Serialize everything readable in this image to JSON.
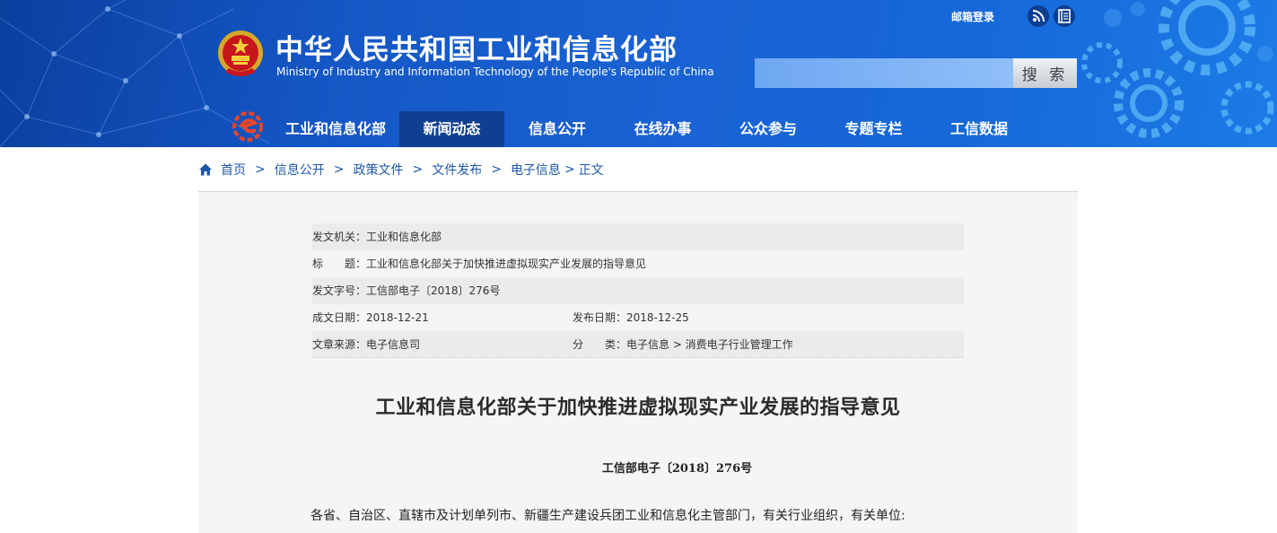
{
  "header": {
    "title": "中华人民共和国工业和信息化部",
    "subtitle": "Ministry of Industry and Information Technology of the People's Republic of China",
    "mail_login": "邮箱登录",
    "search_placeholder": "",
    "search_button": "搜 索"
  },
  "nav": {
    "items": [
      {
        "label": "工业和信息化部",
        "active": false
      },
      {
        "label": "新闻动态",
        "active": true
      },
      {
        "label": "信息公开",
        "active": false
      },
      {
        "label": "在线办事",
        "active": false
      },
      {
        "label": "公众参与",
        "active": false
      },
      {
        "label": "专题专栏",
        "active": false
      },
      {
        "label": "工信数据",
        "active": false
      }
    ]
  },
  "breadcrumb": {
    "items": [
      "首页",
      "信息公开",
      "政策文件",
      "文件发布",
      "电子信息",
      "正文"
    ],
    "separator": ">"
  },
  "meta": {
    "issuer_label": "发文机关：",
    "issuer": "工业和信息化部",
    "title_label": "标　　题：",
    "title": "工业和信息化部关于加快推进虚拟现实产业发展的指导意见",
    "doc_no_label": "发文字号：",
    "doc_no": "工信部电子〔2018〕276号",
    "created_label": "成文日期：",
    "created": "2018-12-21",
    "published_label": "发布日期：",
    "published": "2018-12-25",
    "source_label": "文章来源：",
    "source": "电子信息司",
    "category_label": "分　　类：",
    "category": "电子信息 > 消费电子行业管理工作"
  },
  "document": {
    "title": "工业和信息化部关于加快推进虚拟现实产业发展的指导意见",
    "number": "工信部电子〔2018〕276号",
    "salutation": "各省、自治区、直辖市及计划单列市、新疆生产建设兵团工业和信息化主管部门，有关行业组织，有关单位:"
  },
  "colors": {
    "header_blue": "#1456c4",
    "nav_active": "#0f3f90",
    "link_blue": "#1f57a8",
    "content_bg": "#f5f5f5"
  },
  "icons": [
    "national-emblem-icon",
    "rss-icon",
    "list-icon",
    "miit-logo-icon",
    "home-icon"
  ]
}
